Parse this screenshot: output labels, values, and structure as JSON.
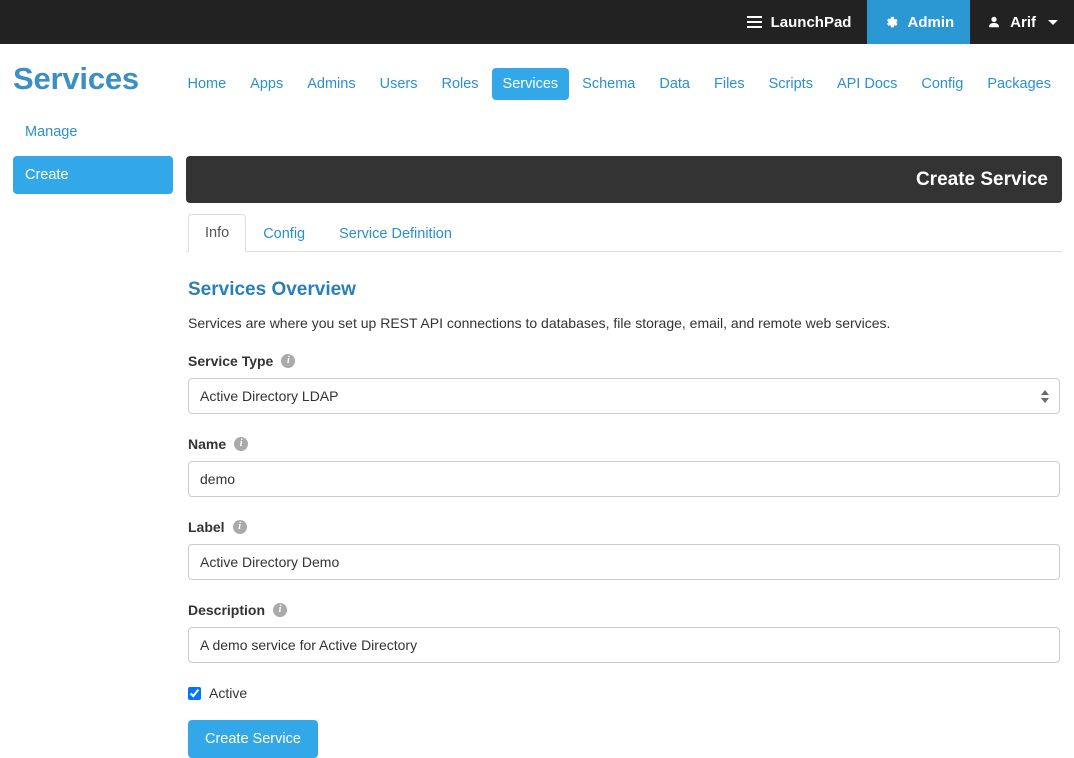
{
  "topbar": {
    "items": [
      {
        "label": "LaunchPad",
        "icon": "hamburger-icon",
        "active": false
      },
      {
        "label": "Admin",
        "icon": "gear-icon",
        "active": true
      },
      {
        "label": "Arif",
        "icon": "user-icon",
        "active": false,
        "caret": true
      }
    ]
  },
  "header": {
    "page_title": "Services"
  },
  "mainnav": {
    "items": [
      "Home",
      "Apps",
      "Admins",
      "Users",
      "Roles",
      "Services",
      "Schema",
      "Data",
      "Files",
      "Scripts",
      "API Docs",
      "Config",
      "Packages"
    ],
    "active": "Services"
  },
  "sidebar": {
    "manage_label": "Manage",
    "create_label": "Create"
  },
  "panel": {
    "title": "Create Service"
  },
  "tabs": {
    "items": [
      "Info",
      "Config",
      "Service Definition"
    ],
    "active": "Info"
  },
  "overview": {
    "title": "Services Overview",
    "description": "Services are where you set up REST API connections to databases, file storage, email, and remote web services."
  },
  "form": {
    "service_type": {
      "label": "Service Type",
      "value": "Active Directory LDAP",
      "options": [
        "Active Directory LDAP"
      ]
    },
    "name": {
      "label": "Name",
      "value": "demo",
      "placeholder": ""
    },
    "label_field": {
      "label": "Label",
      "value": "Active Directory Demo",
      "placeholder": ""
    },
    "description": {
      "label": "Description",
      "value": "A demo service for Active Directory",
      "placeholder": ""
    },
    "active": {
      "label": "Active",
      "checked": true
    },
    "submit_label": "Create Service"
  },
  "colors": {
    "accent_blue": "#33a8e8",
    "link_blue": "#2b8fd4",
    "topbar_dark": "#222222",
    "panel_dark": "#333333",
    "title_blue": "#3b8fc4"
  }
}
